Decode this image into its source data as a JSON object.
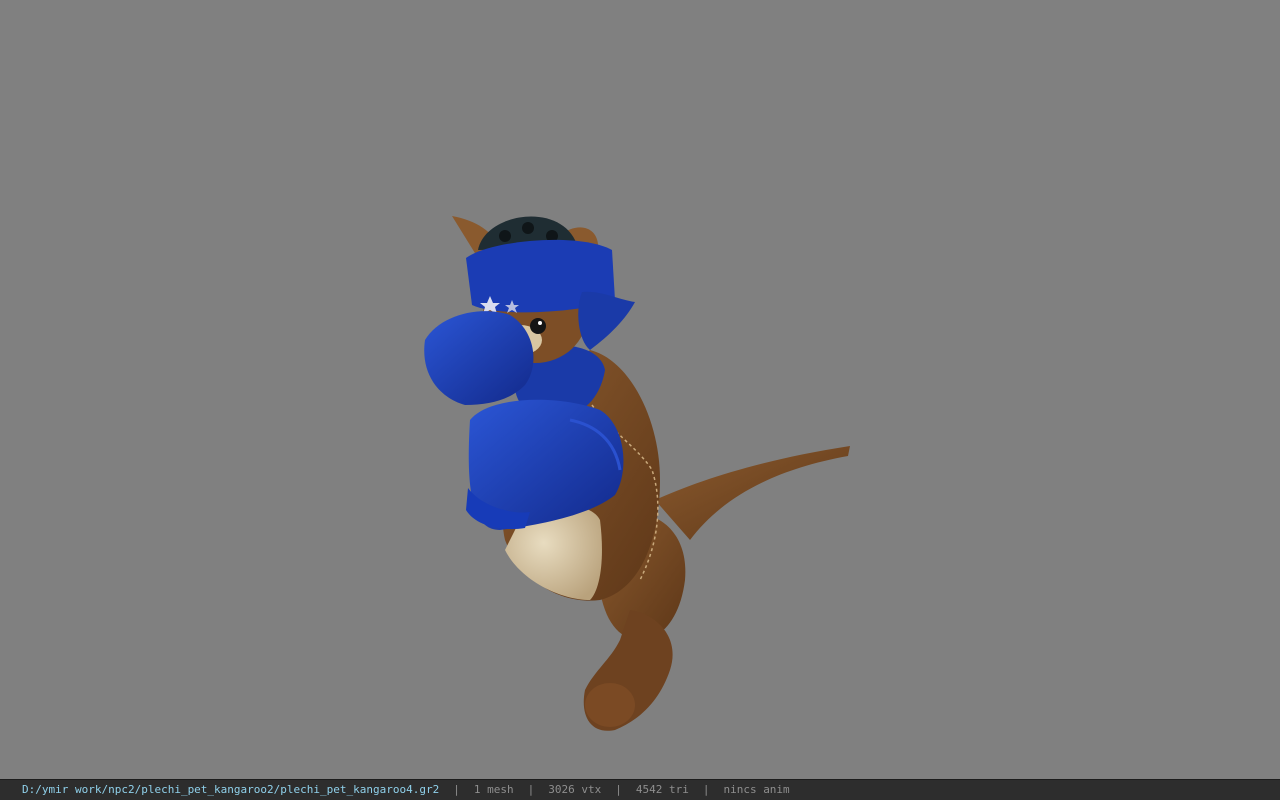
{
  "viewport": {
    "background_color": "#808080",
    "model": {
      "subject": "kangaroo-boxer-model",
      "colors": {
        "fur": "#7a4a22",
        "belly": "#d8c6a2",
        "gear": "#1d3fb0",
        "helmet_top": "#1f2d33"
      }
    }
  },
  "status_bar": {
    "file_path": "D:/ymir work/npc2/plechi_pet_kangaroo2/plechi_pet_kangaroo4.gr2",
    "mesh_count": "1 mesh",
    "vertex_count": "3026 vtx",
    "triangle_count": "4542 tri",
    "anim_status": "nincs anim",
    "separator": "|"
  }
}
